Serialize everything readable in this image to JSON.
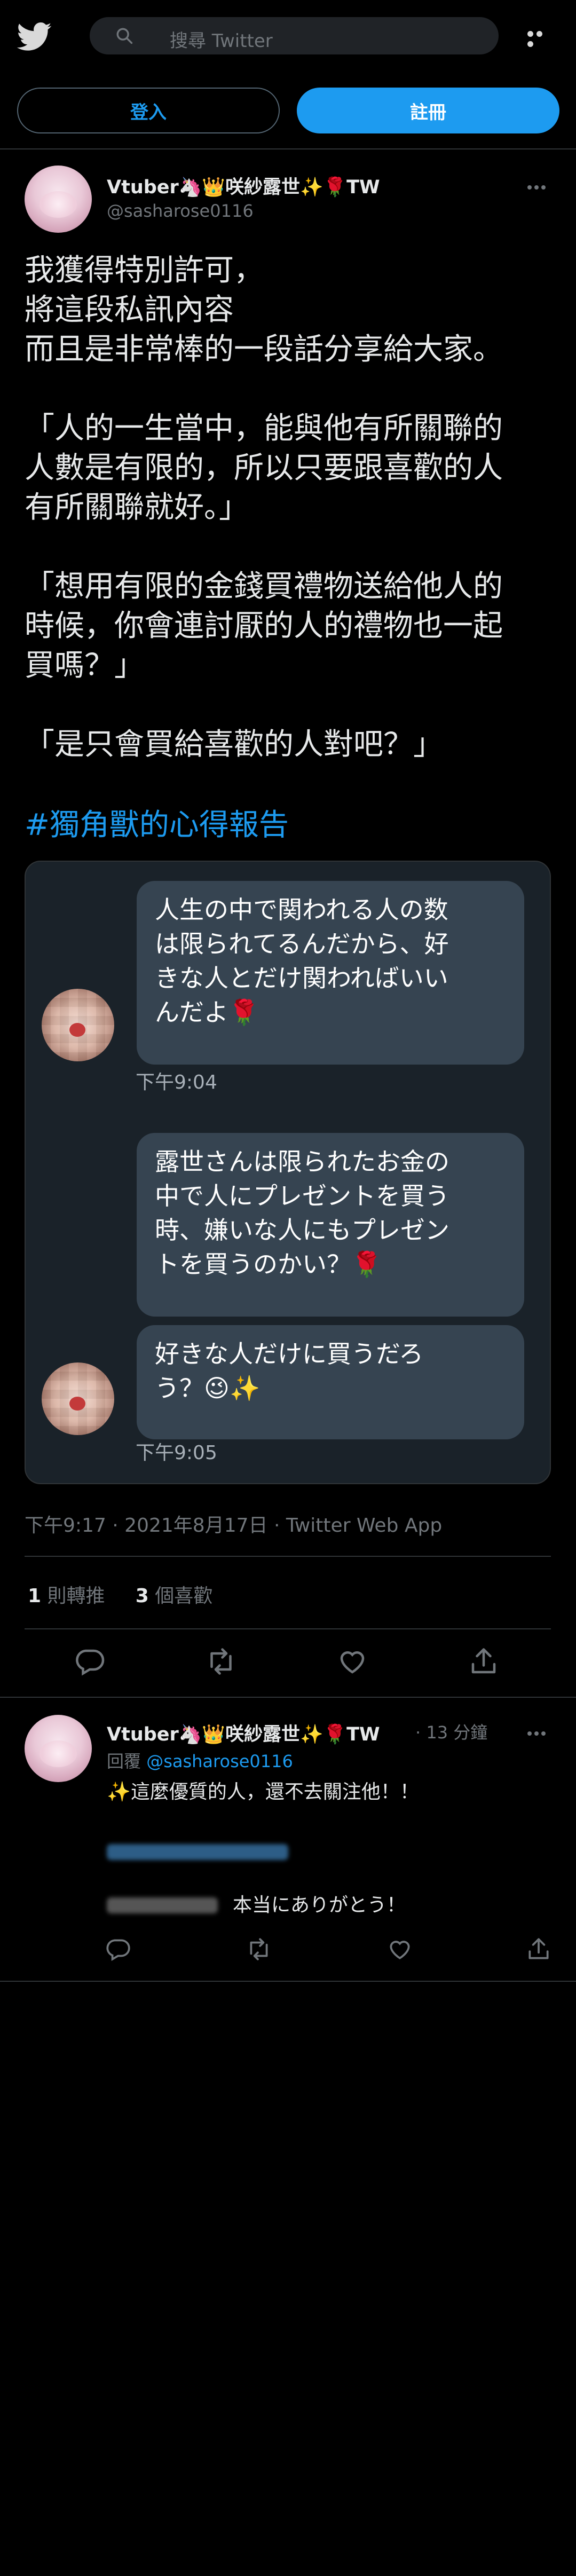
{
  "header": {
    "search_placeholder": "搜尋 Twitter"
  },
  "auth": {
    "login_label": "登入",
    "signup_label": "註冊"
  },
  "tweet": {
    "author_name": "Vtuber🦄👑咲紗露世✨🌹TW",
    "author_handle": "@sasharose0116",
    "text_lines": [
      "我獲得特別許可，",
      "將這段私訊內容",
      "而且是非常棒的一段話分享給大家。",
      "",
      "「人的一生當中，能與他有所關聯的",
      "人數是有限的，所以只要跟喜歡的人",
      "有所關聯就好。」",
      "",
      "「想用有限的金錢買禮物送給他人的",
      "時候，你會連討厭的人的禮物也一起",
      "買嗎？」",
      "",
      "「是只會買給喜歡的人對吧？」"
    ],
    "hashtag": "#獨角獸的心得報告",
    "meta": "下午9:17 · 2021年8月17日 · Twitter Web App",
    "retweets_count": "1",
    "retweets_label": "則轉推",
    "likes_count": "3",
    "likes_label": "個喜歡"
  },
  "chat_image": {
    "messages": [
      {
        "text": "人生の中で関われる人の数\nは限られてるんだから、好\nきな人とだけ関わればいい\nんだよ🌹"
      },
      {
        "text": "露世さんは限られたお金の\n中で人にプレゼントを買う\n時、嫌いな人にもプレゼン\nトを買うのかい？🌹"
      },
      {
        "text": "好きな人だけに買うだろ\nう？😉✨"
      }
    ],
    "times": [
      "下午9:04",
      "下午9:05"
    ]
  },
  "reply": {
    "author_name": "Vtuber🦄👑咲紗露世✨🌹TW",
    "time": "· 13 分鐘",
    "replying_label": "回覆",
    "replying_to": "@sasharose0116",
    "line1": "✨這麼優質的人，還不去關注他！！",
    "line3": "本当にありがとう！"
  },
  "colors": {
    "accent": "#1d9bf0",
    "background": "#000000",
    "bubble": "#364451"
  },
  "icons": [
    "twitter-bird-icon",
    "search-icon",
    "more-icon",
    "reply-icon",
    "retweet-icon",
    "like-icon",
    "share-icon"
  ]
}
